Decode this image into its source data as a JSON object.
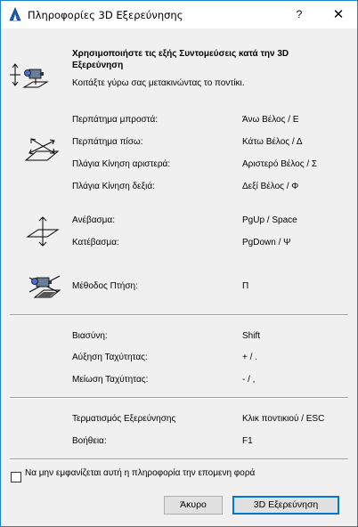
{
  "window": {
    "title": "Πληροφορίες 3D Εξερεύνησης",
    "help_label": "?",
    "close_label": "✕"
  },
  "intro": {
    "heading": "Χρησιμοποιήστε τις εξής Συντομεύσεις κατά την 3D Εξερεύνηση",
    "subtext": "Κοιτάξτε γύρω σας μετακινώντας το ποντίκι."
  },
  "shortcuts": {
    "walk_forward": {
      "label": "Περπάτημα μπροστά:",
      "key": "Άνω Βέλος / Ε"
    },
    "walk_back": {
      "label": "Περπάτημα πίσω:",
      "key": "Κάτω Βέλος / Δ"
    },
    "strafe_left": {
      "label": "Πλάγια Κίνηση αριστερά:",
      "key": "Αριστερό Βέλος / Σ"
    },
    "strafe_right": {
      "label": "Πλάγια Κίνηση δεξιά:",
      "key": "Δεξί Βέλος / Φ"
    },
    "ascend": {
      "label": "Ανέβασμα:",
      "key": "PgUp / Space"
    },
    "descend": {
      "label": "Κατέβασμα:",
      "key": "PgDown / Ψ"
    },
    "fly_mode": {
      "label": "Μέθοδος Πτήση:",
      "key": "Π"
    },
    "hurry": {
      "label": "Βιασύνη:",
      "key": "Shift"
    },
    "speed_up": {
      "label": "Αύξηση Ταχύτητας:",
      "key": "+ / ."
    },
    "speed_down": {
      "label": "Μείωση Ταχύτητας:",
      "key": "- / ,"
    },
    "end_explore": {
      "label": "Τερματισμός Εξερεύνησης",
      "key": "Κλικ ποντικιού / ESC"
    },
    "help": {
      "label": "Βοήθεια:",
      "key": "F1"
    }
  },
  "footer": {
    "checkbox_label": "Να μην εμφανίζεται αυτή η πληροφορία την επομενη φορά",
    "checkbox_checked": false,
    "cancel_label": "Άκυρο",
    "explore_label": "3D Εξερεύνηση"
  },
  "colors": {
    "accent": "#0078d7",
    "window_bg": "#f0f0f0",
    "title_bg": "#ffffff"
  },
  "icons": {
    "app": "archicad-icon",
    "look": "look-around-camera-icon",
    "walk": "walk-arrows-plane-icon",
    "updown": "up-down-arrows-plane-icon",
    "fly": "fly-camera-icon"
  }
}
